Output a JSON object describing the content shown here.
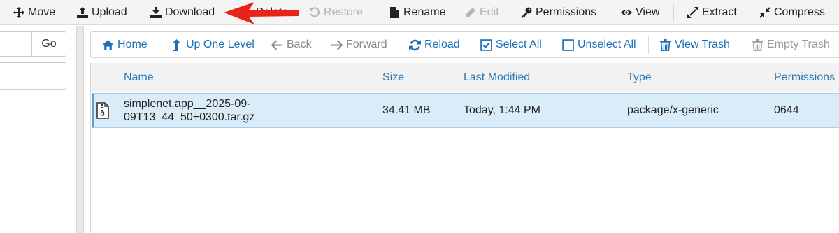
{
  "toolbar": {
    "move": "Move",
    "upload": "Upload",
    "download": "Download",
    "delete": "Delete",
    "restore": "Restore",
    "rename": "Rename",
    "edit": "Edit",
    "permissions": "Permissions",
    "view": "View",
    "extract": "Extract",
    "compress": "Compress"
  },
  "left": {
    "go_label": "Go"
  },
  "nav": {
    "home": "Home",
    "up_one_level": "Up One Level",
    "back": "Back",
    "forward": "Forward",
    "reload": "Reload",
    "select_all": "Select All",
    "unselect_all": "Unselect All",
    "view_trash": "View Trash",
    "empty_trash": "Empty Trash"
  },
  "table": {
    "columns": [
      "Name",
      "Size",
      "Last Modified",
      "Type",
      "Permissions"
    ],
    "rows": [
      {
        "name_line1": "simplenet.app__2025-09-",
        "name_line2": "09T13_44_50+0300.tar.gz",
        "size": "34.41 MB",
        "modified": "Today, 1:44 PM",
        "type": "package/x-generic",
        "permissions": "0644"
      }
    ]
  },
  "colors": {
    "link_blue": "#1d6fb8",
    "selected_row": "#d9ecf8",
    "annotation_arrow": "#e8231b"
  },
  "icons": {
    "move": "arrows-move-icon",
    "upload": "upload-icon",
    "download": "download-icon",
    "restore": "restore-icon",
    "rename": "file-icon",
    "edit": "pencil-icon",
    "permissions": "key-icon",
    "view": "eye-icon",
    "extract": "expand-icon",
    "compress": "compress-icon",
    "home": "home-icon",
    "up": "level-up-icon",
    "back": "arrow-left-icon",
    "forward": "arrow-right-icon",
    "reload": "refresh-icon",
    "select_all": "checked-box-icon",
    "unselect_all": "empty-box-icon",
    "trash": "trash-icon",
    "archive": "zip-file-icon"
  }
}
